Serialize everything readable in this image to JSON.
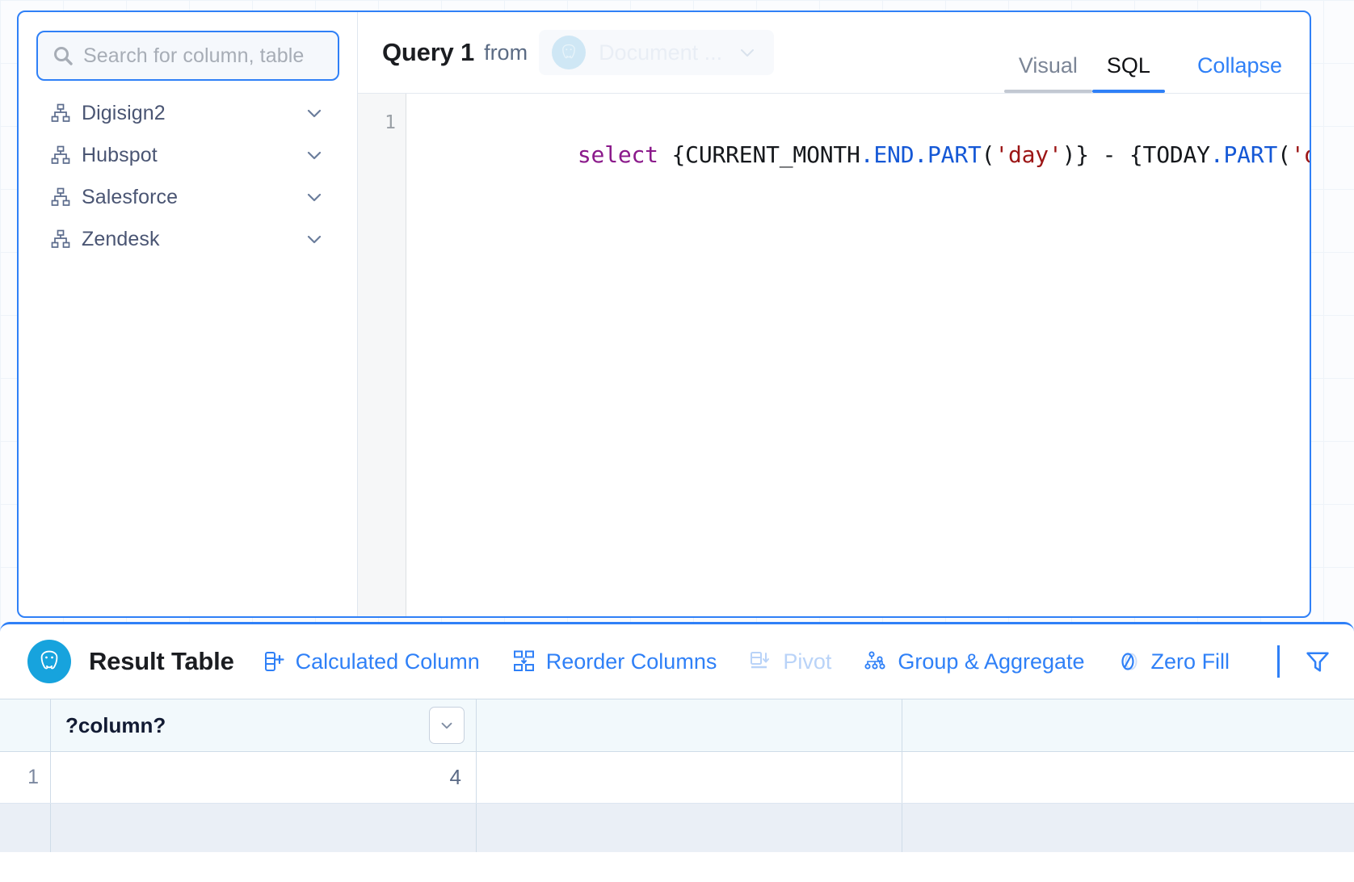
{
  "sidebar": {
    "search": {
      "placeholder": "Search for column, table",
      "icon": "search-icon"
    },
    "items": [
      {
        "label": "Digisign2",
        "icon": "sitemap-icon",
        "chevron": "chevron-down-icon"
      },
      {
        "label": "Hubspot",
        "icon": "sitemap-icon",
        "chevron": "chevron-down-icon"
      },
      {
        "label": "Salesforce",
        "icon": "sitemap-icon",
        "chevron": "chevron-down-icon"
      },
      {
        "label": "Zendesk",
        "icon": "sitemap-icon",
        "chevron": "chevron-down-icon"
      }
    ]
  },
  "editor": {
    "query_title": "Query 1",
    "from_label": "from",
    "datasource": {
      "name": "Document ...",
      "icon": "postgresql-elephant-icon",
      "chevron": "chevron-down-icon"
    },
    "tabs": [
      {
        "label": "Visual",
        "active": false
      },
      {
        "label": "SQL",
        "active": true
      }
    ],
    "collapse_label": "Collapse",
    "line_number": "1",
    "sql_tokens": [
      {
        "text": "select",
        "type": "keyword"
      },
      {
        "text": " {CURRENT_MONTH",
        "type": "plain"
      },
      {
        "text": ".END.PART",
        "type": "function"
      },
      {
        "text": "(",
        "type": "plain"
      },
      {
        "text": "'day'",
        "type": "string"
      },
      {
        "text": ")} - {TODAY",
        "type": "plain"
      },
      {
        "text": ".PART",
        "type": "function"
      },
      {
        "text": "(",
        "type": "plain"
      },
      {
        "text": "'day'",
        "type": "string"
      },
      {
        "text": ")}",
        "type": "plain"
      }
    ],
    "sql_text": "select {CURRENT_MONTH.END.PART('day')} - {TODAY.PART('day')}"
  },
  "result_table": {
    "badge_icon": "postgresql-elephant-icon",
    "title": "Result Table",
    "toolbar": [
      {
        "label": "Calculated Column",
        "icon": "calculated-column-icon",
        "disabled": false
      },
      {
        "label": "Reorder Columns",
        "icon": "reorder-columns-icon",
        "disabled": false
      },
      {
        "label": "Pivot",
        "icon": "pivot-icon",
        "disabled": true
      },
      {
        "label": "Group & Aggregate",
        "icon": "group-aggregate-icon",
        "disabled": false
      },
      {
        "label": "Zero Fill",
        "icon": "zero-fill-icon",
        "disabled": false
      }
    ],
    "filter_icon": "filter-funnel-icon",
    "columns": [
      "?column?",
      "",
      ""
    ],
    "rows": [
      {
        "number": "1",
        "values": [
          "4",
          "",
          ""
        ]
      }
    ]
  },
  "colors": {
    "accent_blue": "#2f80f7",
    "panel_border": "#2f80f7",
    "pg_badge": "#17a3dd",
    "keyword_purple": "#8b1a8b",
    "function_blue": "#1558d6",
    "string_red": "#9c1616",
    "header_bg": "#f2f9fc",
    "disabled_blue": "#b9d3f8"
  }
}
